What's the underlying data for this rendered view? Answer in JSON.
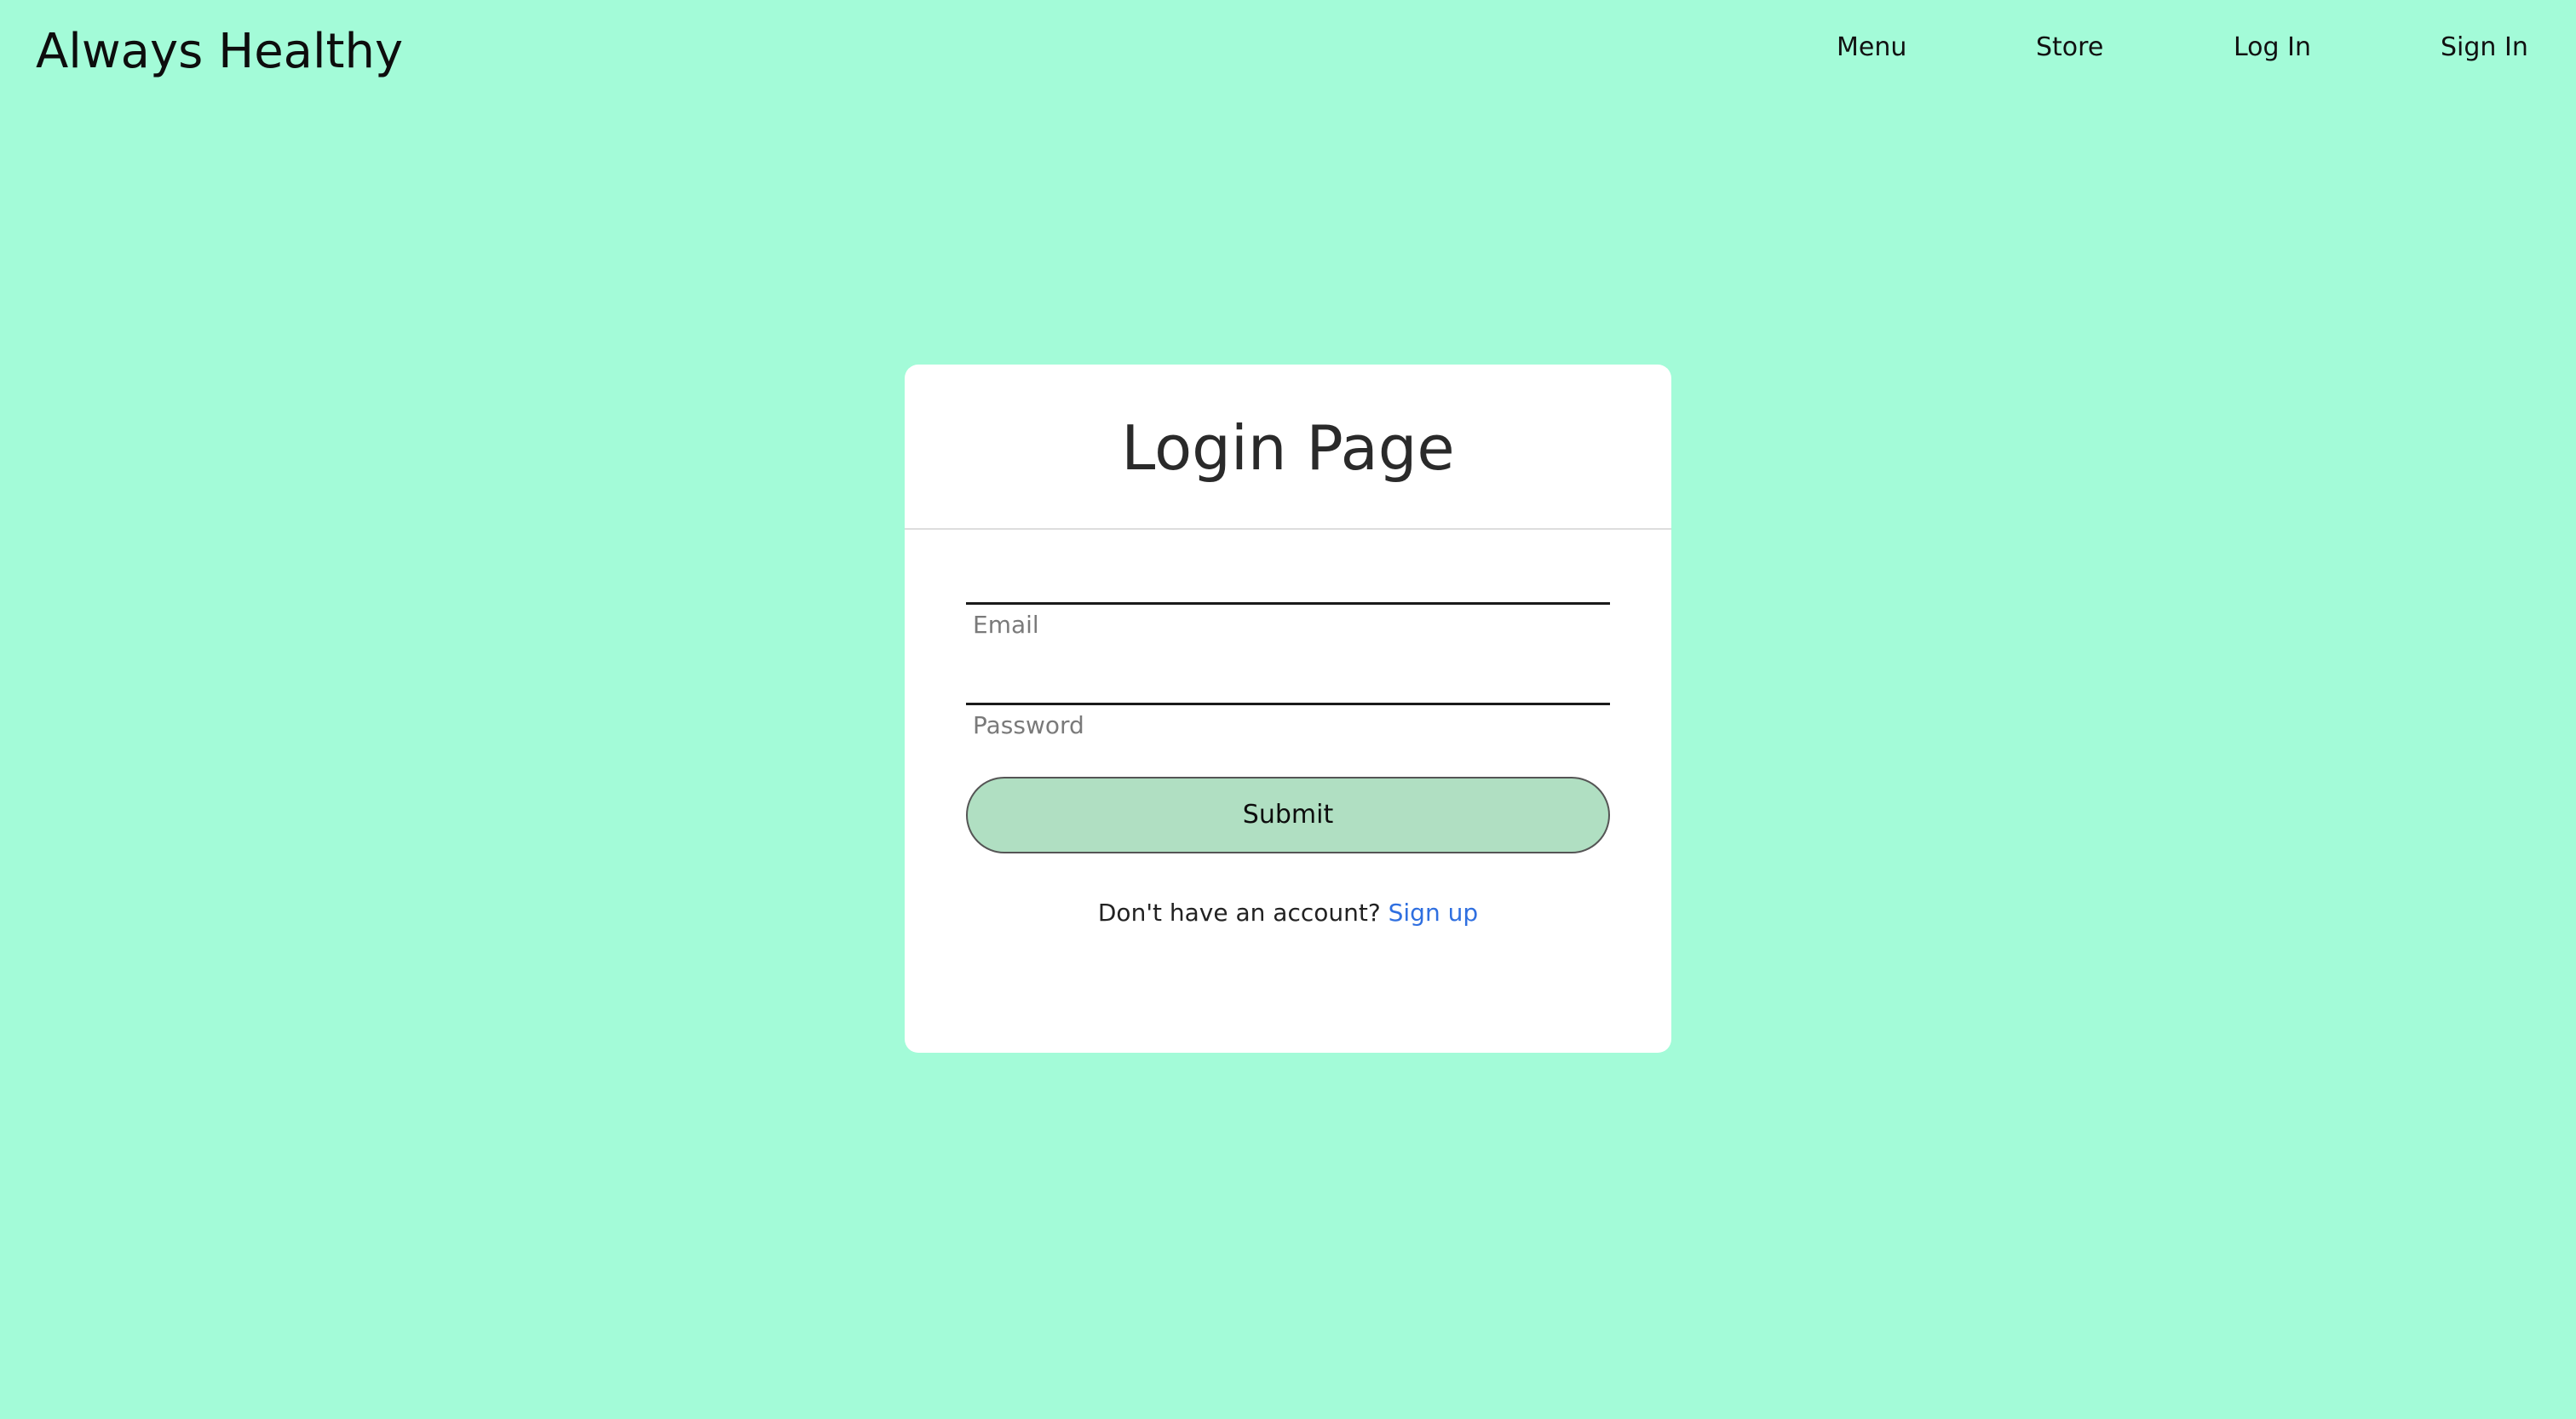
{
  "brand": {
    "title": "Always Healthy"
  },
  "nav": {
    "menu": "Menu",
    "store": "Store",
    "login": "Log In",
    "signin": "Sign In"
  },
  "login_card": {
    "title": "Login Page",
    "email_label": "Email",
    "email_value": "",
    "password_label": "Password",
    "password_value": "",
    "submit_label": "Submit",
    "signup_prompt": "Don't have an account?",
    "signup_link": "Sign up"
  },
  "colors": {
    "page_background": "#a3fbd8",
    "card_background": "#ffffff",
    "button_background": "#b0dfc2",
    "link": "#2f6fe0"
  }
}
